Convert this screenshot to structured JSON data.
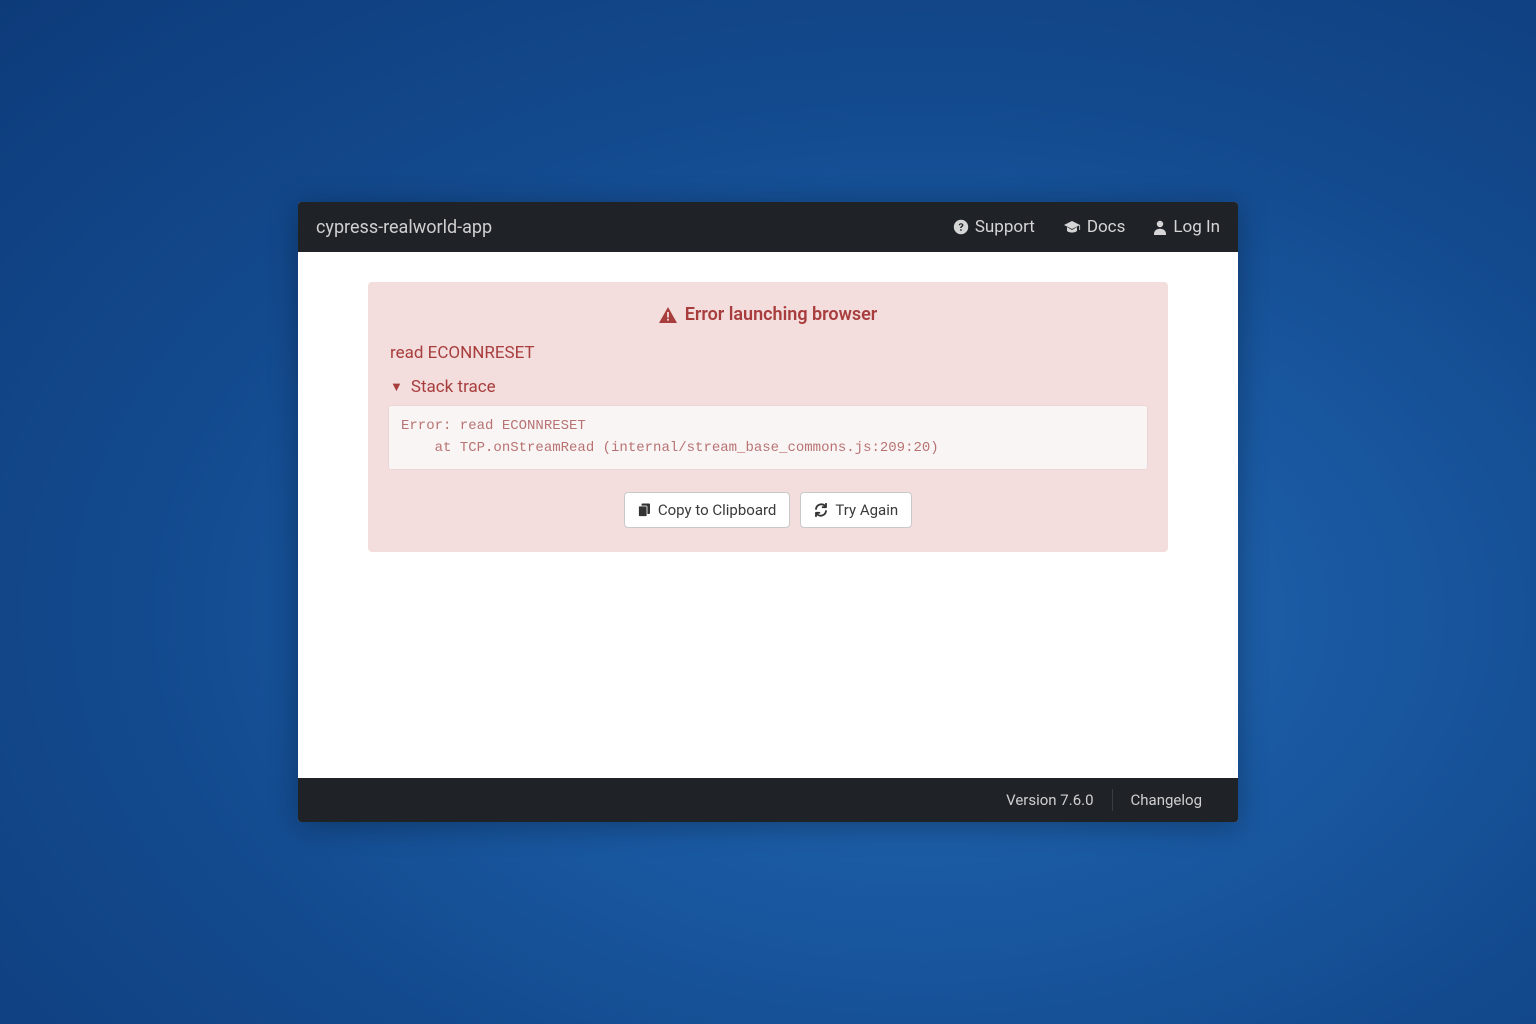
{
  "header": {
    "app_title": "cypress-realworld-app",
    "links": {
      "support": "Support",
      "docs": "Docs",
      "login": "Log In"
    }
  },
  "error": {
    "title": "Error launching browser",
    "message": "read ECONNRESET",
    "stack_trace_label": "Stack trace",
    "stack_trace": "Error: read ECONNRESET\n    at TCP.onStreamRead (internal/stream_base_commons.js:209:20)",
    "buttons": {
      "copy": "Copy to Clipboard",
      "retry": "Try Again"
    }
  },
  "footer": {
    "version": "Version 7.6.0",
    "changelog": "Changelog"
  }
}
